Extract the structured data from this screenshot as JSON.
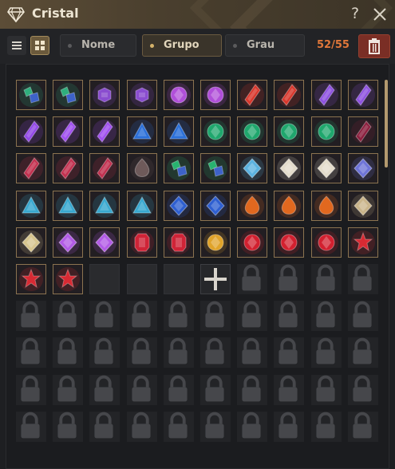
{
  "window": {
    "title": "Cristal"
  },
  "toolbar": {
    "sort_tabs": [
      {
        "label": "Nome",
        "selected": false
      },
      {
        "label": "Grupo",
        "selected": true
      },
      {
        "label": "Grau",
        "selected": false
      }
    ],
    "capacity": "52/55"
  },
  "colors": {
    "accent": "#8b7350",
    "count": "#e0773a",
    "trash": "#7a2e25",
    "title_bar": "#4a3f2e"
  },
  "inventory": {
    "slots": [
      {
        "state": "item",
        "gem": "emerald-sapphire-pair",
        "color": "#2fae7d"
      },
      {
        "state": "item",
        "gem": "emerald-sapphire-pair",
        "color": "#2fae7d"
      },
      {
        "state": "item",
        "gem": "amethyst-hexagon",
        "color": "#8a4dcf"
      },
      {
        "state": "item",
        "gem": "amethyst-hexagon",
        "color": "#8a4dcf"
      },
      {
        "state": "item",
        "gem": "amethyst-round",
        "color": "#b04fd9"
      },
      {
        "state": "item",
        "gem": "amethyst-round",
        "color": "#b04fd9"
      },
      {
        "state": "item",
        "gem": "ruby-shard",
        "color": "#d8372c"
      },
      {
        "state": "item",
        "gem": "ruby-shard",
        "color": "#d8372c"
      },
      {
        "state": "item",
        "gem": "amethyst-shard",
        "color": "#8e52e0"
      },
      {
        "state": "item",
        "gem": "amethyst-shard",
        "color": "#8e52e0"
      },
      {
        "state": "item",
        "gem": "amethyst-cluster",
        "color": "#9248e6"
      },
      {
        "state": "item",
        "gem": "amethyst-cluster",
        "color": "#a050ee"
      },
      {
        "state": "item",
        "gem": "amethyst-cluster",
        "color": "#a050ee"
      },
      {
        "state": "item",
        "gem": "sapphire-trillion",
        "color": "#2a6fd8"
      },
      {
        "state": "item",
        "gem": "sapphire-trillion",
        "color": "#2a6fd8"
      },
      {
        "state": "item",
        "gem": "emerald-oval",
        "color": "#1fa76d"
      },
      {
        "state": "item",
        "gem": "emerald-oval",
        "color": "#1fa76d"
      },
      {
        "state": "item",
        "gem": "emerald-oval",
        "color": "#1fa76d"
      },
      {
        "state": "item",
        "gem": "emerald-oval",
        "color": "#1fa76d"
      },
      {
        "state": "item",
        "gem": "garnet-dark",
        "color": "#8c1f3e"
      },
      {
        "state": "item",
        "gem": "garnet-shard",
        "color": "#c2304f"
      },
      {
        "state": "item",
        "gem": "garnet-shard",
        "color": "#c2304f"
      },
      {
        "state": "item",
        "gem": "garnet-shard",
        "color": "#c2304f"
      },
      {
        "state": "item",
        "gem": "obsidian-drop",
        "color": "#6e5a5a"
      },
      {
        "state": "item",
        "gem": "emerald-shards",
        "color": "#28b36f"
      },
      {
        "state": "item",
        "gem": "emerald-shards",
        "color": "#28b36f"
      },
      {
        "state": "item",
        "gem": "aquamarine-diamond",
        "color": "#5bb2e0"
      },
      {
        "state": "item",
        "gem": "white-diamond",
        "color": "#e3dccb"
      },
      {
        "state": "item",
        "gem": "white-diamond",
        "color": "#e3dccb"
      },
      {
        "state": "item",
        "gem": "tanzanite-diamond",
        "color": "#6e74d8"
      },
      {
        "state": "item",
        "gem": "aquamarine-crystal",
        "color": "#38a8cf"
      },
      {
        "state": "item",
        "gem": "aquamarine-crystal",
        "color": "#38a8cf"
      },
      {
        "state": "item",
        "gem": "aquamarine-crystal",
        "color": "#38a8cf"
      },
      {
        "state": "item",
        "gem": "aquamarine-crystal",
        "color": "#38a8cf"
      },
      {
        "state": "item",
        "gem": "sapphire-brilliant",
        "color": "#2e5fd1"
      },
      {
        "state": "item",
        "gem": "sapphire-brilliant",
        "color": "#2e5fd1"
      },
      {
        "state": "item",
        "gem": "topaz-pear",
        "color": "#e1681f"
      },
      {
        "state": "item",
        "gem": "topaz-pear",
        "color": "#e1681f"
      },
      {
        "state": "item",
        "gem": "topaz-pear",
        "color": "#e1681f"
      },
      {
        "state": "item",
        "gem": "smoky-diamond",
        "color": "#c9b48a"
      },
      {
        "state": "item",
        "gem": "citrine-diamond",
        "color": "#d6c48e"
      },
      {
        "state": "item",
        "gem": "amethyst-brilliant",
        "color": "#b25be6"
      },
      {
        "state": "item",
        "gem": "amethyst-brilliant",
        "color": "#b25be6"
      },
      {
        "state": "item",
        "gem": "ruby-emerald-cut",
        "color": "#cf2437"
      },
      {
        "state": "item",
        "gem": "ruby-emerald-cut",
        "color": "#cf2437"
      },
      {
        "state": "item",
        "gem": "golden-sun",
        "color": "#e0a32a"
      },
      {
        "state": "item",
        "gem": "ruby-round",
        "color": "#d2202f"
      },
      {
        "state": "item",
        "gem": "ruby-round",
        "color": "#d2202f"
      },
      {
        "state": "item",
        "gem": "ruby-round",
        "color": "#d2202f"
      },
      {
        "state": "item",
        "gem": "ruby-star",
        "color": "#d82a33"
      },
      {
        "state": "item",
        "gem": "ruby-star",
        "color": "#d82a33"
      },
      {
        "state": "item",
        "gem": "ruby-star",
        "color": "#d82a33"
      },
      {
        "state": "empty"
      },
      {
        "state": "empty"
      },
      {
        "state": "empty"
      },
      {
        "state": "add"
      },
      {
        "state": "locked"
      },
      {
        "state": "locked"
      },
      {
        "state": "locked"
      },
      {
        "state": "locked"
      },
      {
        "state": "locked"
      },
      {
        "state": "locked"
      },
      {
        "state": "locked"
      },
      {
        "state": "locked"
      },
      {
        "state": "locked"
      },
      {
        "state": "locked"
      },
      {
        "state": "locked"
      },
      {
        "state": "locked"
      },
      {
        "state": "locked"
      },
      {
        "state": "locked"
      },
      {
        "state": "locked"
      },
      {
        "state": "locked"
      },
      {
        "state": "locked"
      },
      {
        "state": "locked"
      },
      {
        "state": "locked"
      },
      {
        "state": "locked"
      },
      {
        "state": "locked"
      },
      {
        "state": "locked"
      },
      {
        "state": "locked"
      },
      {
        "state": "locked"
      },
      {
        "state": "locked"
      },
      {
        "state": "locked"
      },
      {
        "state": "locked"
      },
      {
        "state": "locked"
      },
      {
        "state": "locked"
      },
      {
        "state": "locked"
      },
      {
        "state": "locked"
      },
      {
        "state": "locked"
      },
      {
        "state": "locked"
      },
      {
        "state": "locked"
      },
      {
        "state": "locked"
      },
      {
        "state": "locked"
      },
      {
        "state": "locked"
      },
      {
        "state": "locked"
      },
      {
        "state": "locked"
      },
      {
        "state": "locked"
      },
      {
        "state": "locked"
      },
      {
        "state": "locked"
      },
      {
        "state": "locked"
      },
      {
        "state": "locked"
      }
    ]
  }
}
